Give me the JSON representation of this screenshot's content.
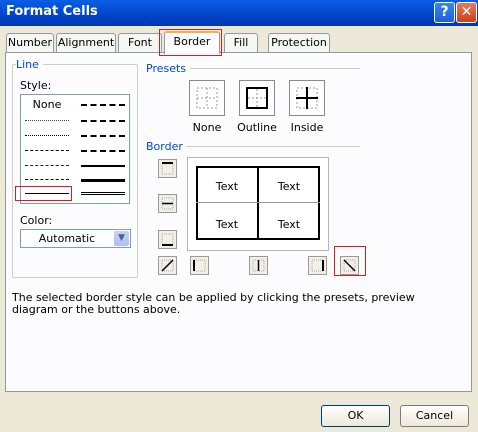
{
  "window": {
    "title": "Format Cells",
    "help_glyph": "?",
    "close_glyph": "✕"
  },
  "tabs": [
    {
      "label": "Number",
      "active": false
    },
    {
      "label": "Alignment",
      "active": false
    },
    {
      "label": "Font",
      "active": false
    },
    {
      "label": "Border",
      "active": true
    },
    {
      "label": "Fill",
      "active": false
    },
    {
      "label": "Protection",
      "active": false
    }
  ],
  "line_group": {
    "title": "Line",
    "style_label": "Style:",
    "styles": [
      "None",
      "dash-dot-dot",
      "dotted",
      "dash-dot-dot-medium",
      "dense-dotted",
      "dash-dot-medium",
      "dash-dot",
      "dashed-medium",
      "dashed",
      "thick-solid",
      "thin-solid",
      "double"
    ],
    "selected_style": "thin-solid",
    "color_label": "Color:",
    "color_value": "Automatic"
  },
  "presets": {
    "title": "Presets",
    "items": [
      {
        "label": "None",
        "icon": "preset-none-icon"
      },
      {
        "label": "Outline",
        "icon": "preset-outline-icon"
      },
      {
        "label": "Inside",
        "icon": "preset-inside-icon"
      }
    ]
  },
  "border": {
    "title": "Border",
    "preview_cells": [
      "Text",
      "Text",
      "Text",
      "Text"
    ],
    "buttons": [
      "border-top-icon",
      "border-inside-horizontal-icon",
      "border-bottom-icon",
      "border-diagonal-up-icon",
      "border-left-icon",
      "border-inside-vertical-icon",
      "border-right-icon",
      "border-diagonal-down-icon"
    ]
  },
  "info_text": "The selected border style can be applied by clicking the presets, preview diagram or the buttons above.",
  "footer": {
    "ok": "OK",
    "cancel": "Cancel"
  },
  "colors": {
    "accent": "#0046d5",
    "highlight": "#d02020",
    "titlebar": "#0043c8"
  }
}
